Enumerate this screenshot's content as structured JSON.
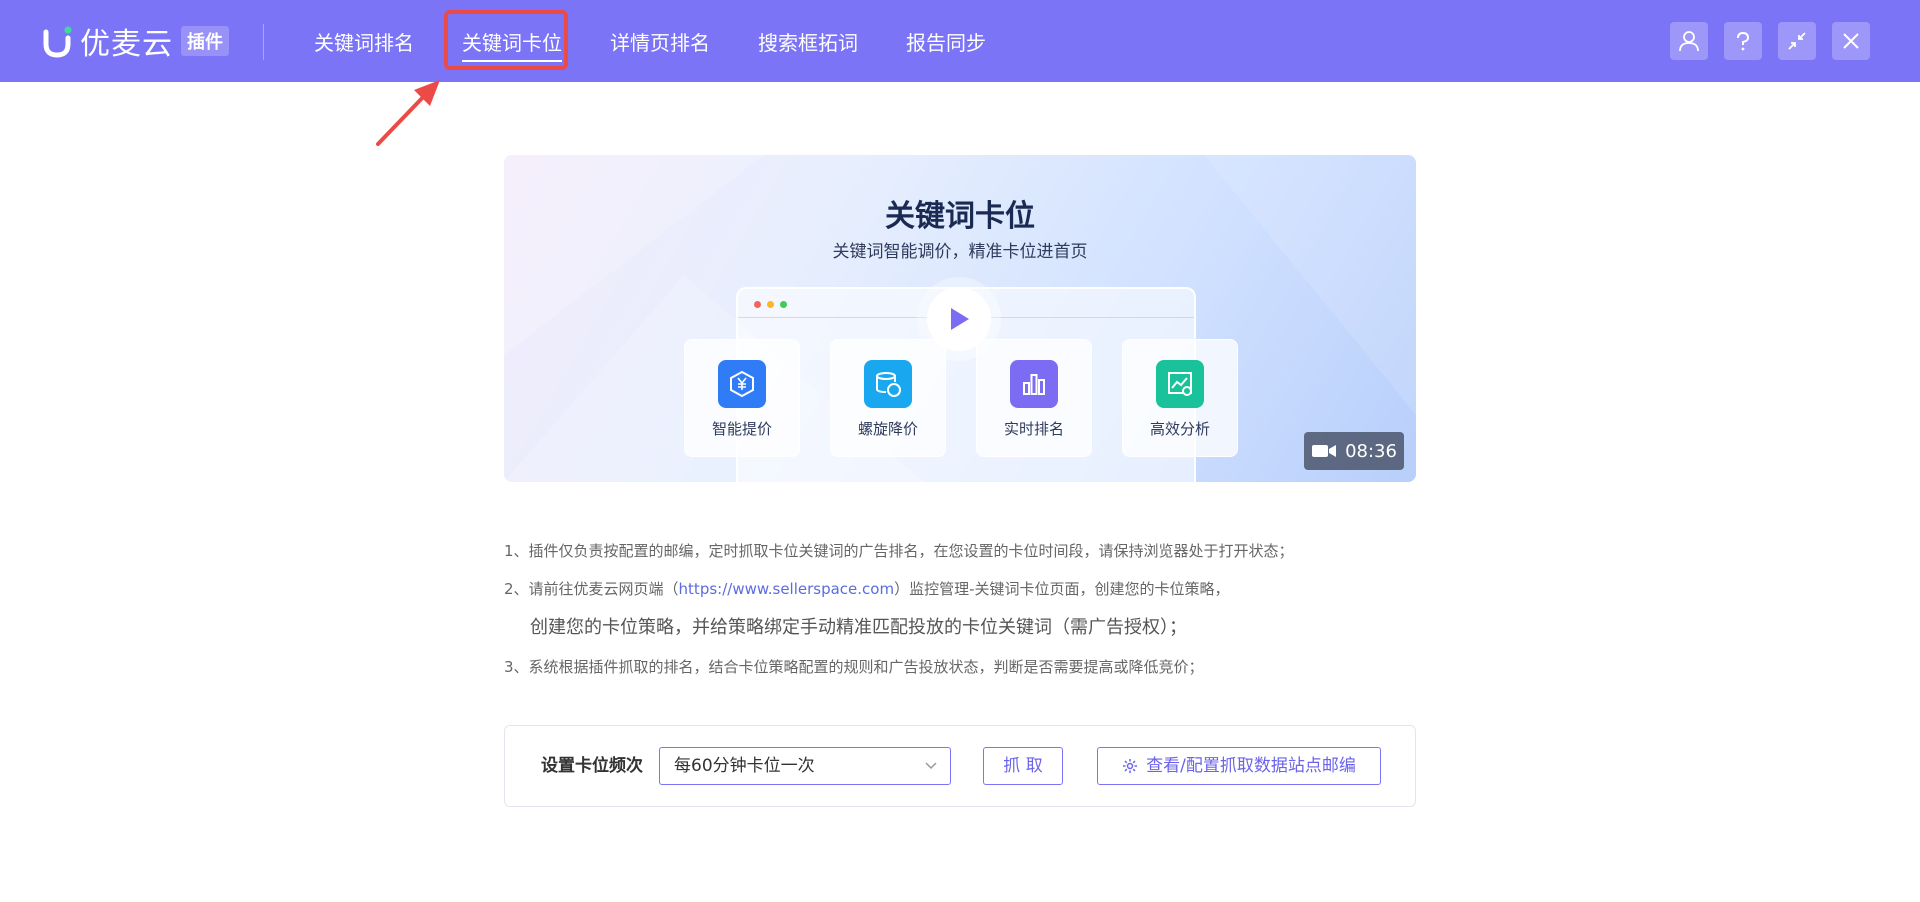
{
  "header": {
    "logo_text": "优麦云",
    "logo_badge": "插件",
    "nav": [
      {
        "label": "关键词排名"
      },
      {
        "label": "关键词卡位"
      },
      {
        "label": "详情页排名"
      },
      {
        "label": "搜索框拓词"
      },
      {
        "label": "报告同步"
      }
    ],
    "active_index": 1,
    "buttons": [
      "user-icon",
      "help-icon",
      "minimize-icon",
      "close-icon"
    ]
  },
  "banner": {
    "title": "关键词卡位",
    "subtitle": "关键词智能调价，精准卡位进首页",
    "features": [
      {
        "label": "智能提价",
        "icon": "yen-shield-icon",
        "color": "#2f7cf6"
      },
      {
        "label": "螺旋降价",
        "icon": "database-yen-icon",
        "color": "#19a8f0"
      },
      {
        "label": "实时排名",
        "icon": "bar-chart-icon",
        "color": "#7b6cf3"
      },
      {
        "label": "高效分析",
        "icon": "analysis-image-icon",
        "color": "#19c29a"
      }
    ],
    "duration": "08:36"
  },
  "notes": {
    "line1": "1、插件仅负责按配置的邮编，定时抓取卡位关键词的广告排名，在您设置的卡位时间段，请保持浏览器处于打开状态；",
    "line2_prefix": "2、请前往优麦云网页端（",
    "line2_link": "https://www.sellerspace.com",
    "line2_suffix": "）监控管理-关键词卡位页面，创建您的卡位策略，",
    "line2_cont": "创建您的卡位策略，并给策略绑定手动精准匹配投放的卡位关键词（需广告授权）；",
    "line3": "3、系统根据插件抓取的排名，结合卡位策略配置的规则和广告投放状态，判断是否需要提高或降低竞价；"
  },
  "settings": {
    "label": "设置卡位频次",
    "frequency_value": "每60分钟卡位一次",
    "fetch_button": "抓 取",
    "config_button": "查看/配置抓取数据站点邮编"
  },
  "colors": {
    "header_bg": "#7b74f6",
    "highlight": "#ec4a46",
    "accent": "#6b63ea"
  }
}
